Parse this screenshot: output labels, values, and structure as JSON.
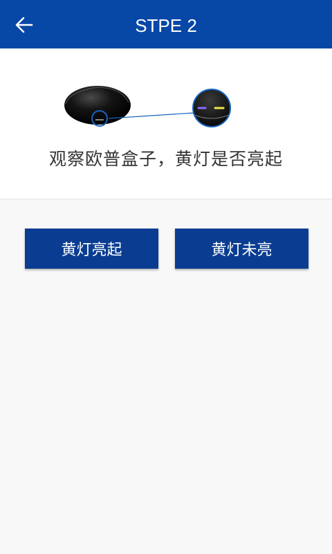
{
  "header": {
    "title": "STPE 2",
    "back_icon": "arrow-left-icon"
  },
  "illustration": {
    "device_color": "#111111",
    "indicator_colors": [
      "#8a6cff",
      "#f2e64d"
    ],
    "ring_color": "#1565c0"
  },
  "instruction": "观察欧普盒子，黄灯是否亮起",
  "actions": {
    "yes_label": "黄灯亮起",
    "no_label": "黄灯未亮"
  },
  "colors": {
    "accent": "#0747a6",
    "button": "#0a3d91"
  }
}
